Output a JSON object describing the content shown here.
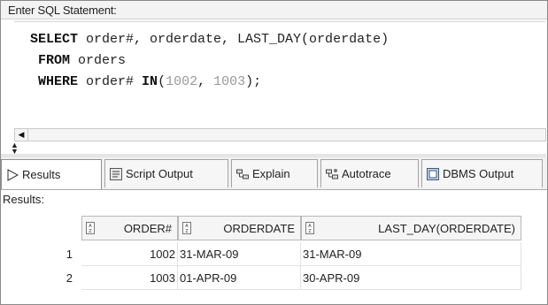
{
  "editor": {
    "header_label": "Enter SQL Statement:",
    "sql": {
      "kw_select": "SELECT",
      "line1_rest": " order#, orderdate, LAST_DAY(orderdate)",
      "kw_from": "FROM",
      "line2_rest": " orders",
      "kw_where": "WHERE",
      "line3_a": " order# ",
      "kw_in": "IN",
      "line3_b": "(",
      "num1": "1002",
      "line3_c": ", ",
      "num2": "1003",
      "line3_d": ");"
    }
  },
  "tabs": [
    {
      "label": "Results",
      "icon": "play-icon",
      "active": true
    },
    {
      "label": "Script Output",
      "icon": "script-output-icon",
      "active": false
    },
    {
      "label": "Explain",
      "icon": "explain-plan-icon",
      "active": false
    },
    {
      "label": "Autotrace",
      "icon": "autotrace-icon",
      "active": false
    },
    {
      "label": "DBMS Output",
      "icon": "dbms-output-icon",
      "active": false
    }
  ],
  "results": {
    "label": "Results:",
    "columns": [
      "ORDER#",
      "ORDERDATE",
      "LAST_DAY(ORDERDATE)"
    ],
    "rows": [
      {
        "num": "1",
        "cells": [
          "1002",
          "31-MAR-09",
          "31-MAR-09"
        ]
      },
      {
        "num": "2",
        "cells": [
          "1003",
          "01-APR-09",
          "30-APR-09"
        ]
      }
    ]
  },
  "colors": {
    "frame": "#8a8a8a",
    "keyword": "#111111",
    "number_literal": "#9a9a9a",
    "tab_active_bg": "#ffffff",
    "header_bg": "#f5f5f5"
  }
}
